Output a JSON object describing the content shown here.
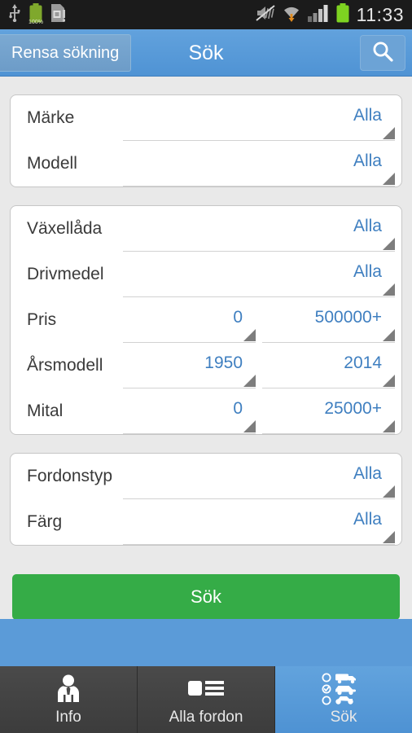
{
  "statusbar": {
    "time": "11:33",
    "battery_percent": "100%",
    "left_icons": [
      "usb-icon",
      "battery-percent-icon",
      "sim-card-alert-icon"
    ],
    "right_icons": [
      "mute-icon",
      "wifi-download-icon",
      "signal-bars-icon",
      "battery-icon"
    ]
  },
  "header": {
    "clear_label": "Rensa sökning",
    "title": "Sök",
    "search_icon": "search-icon",
    "background_color": "#4f93d4"
  },
  "cards": [
    {
      "rows": [
        {
          "label": "Märke",
          "spinners": [
            {
              "value": "Alla"
            }
          ]
        },
        {
          "label": "Modell",
          "spinners": [
            {
              "value": "Alla"
            }
          ]
        }
      ]
    },
    {
      "rows": [
        {
          "label": "Växellåda",
          "spinners": [
            {
              "value": "Alla"
            }
          ]
        },
        {
          "label": "Drivmedel",
          "spinners": [
            {
              "value": "Alla"
            }
          ]
        },
        {
          "label": "Pris",
          "spinners": [
            {
              "value": "0"
            },
            {
              "value": "500000+"
            }
          ]
        },
        {
          "label": "Årsmodell",
          "spinners": [
            {
              "value": "1950"
            },
            {
              "value": "2014"
            }
          ]
        },
        {
          "label": "Mital",
          "spinners": [
            {
              "value": "0"
            },
            {
              "value": "25000+"
            }
          ]
        }
      ]
    },
    {
      "rows": [
        {
          "label": "Fordonstyp",
          "spinners": [
            {
              "value": "Alla"
            }
          ]
        },
        {
          "label": "Färg",
          "spinners": [
            {
              "value": "Alla"
            }
          ]
        }
      ]
    }
  ],
  "submit": {
    "label": "Sök",
    "color": "#35ac47"
  },
  "navbar": {
    "items": [
      {
        "label": "Info",
        "icon": "person-suit-icon",
        "selected": false
      },
      {
        "label": "Alla fordon",
        "icon": "list-icon",
        "selected": false
      },
      {
        "label": "Sök",
        "icon": "vehicle-select-icon",
        "selected": true
      }
    ],
    "selected_color": "#4e92d3"
  }
}
